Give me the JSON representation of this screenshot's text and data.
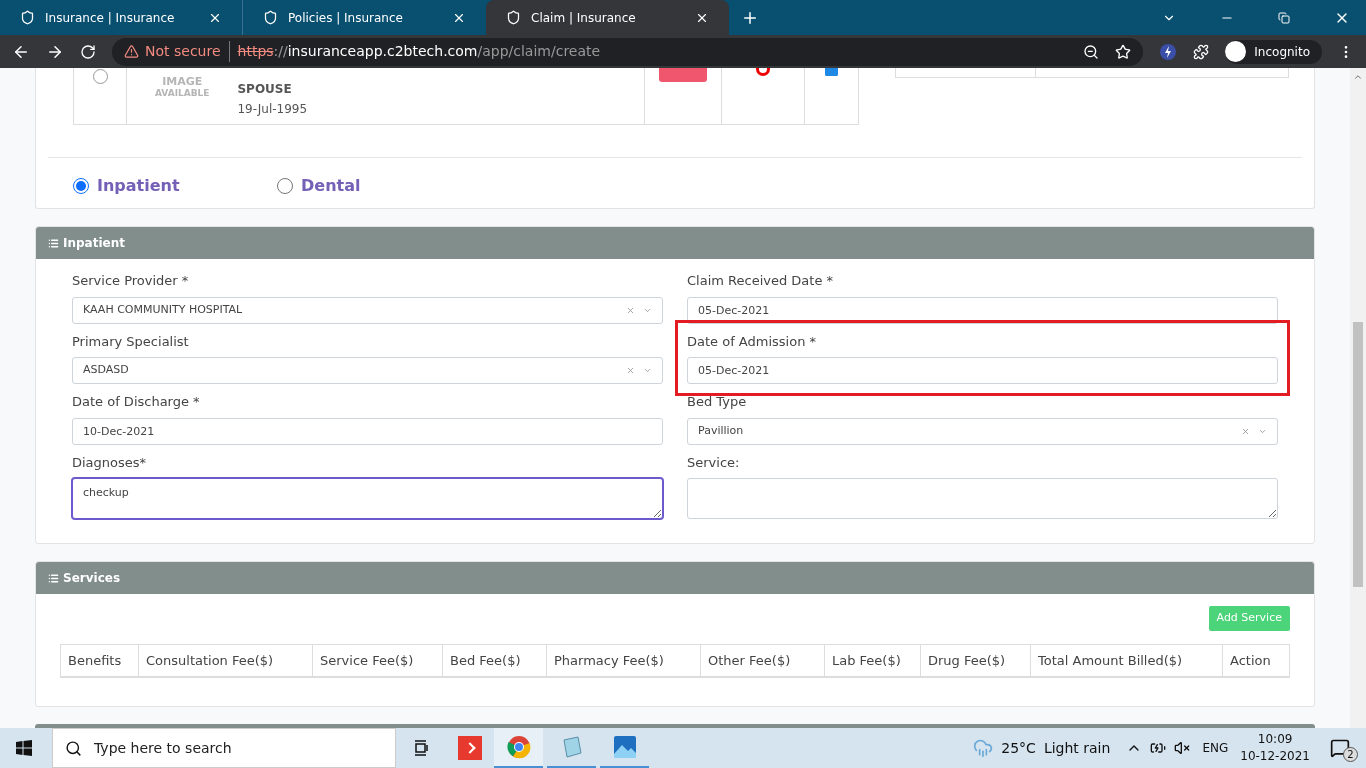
{
  "browser": {
    "tabs": [
      {
        "title": "Insurance | Insurance",
        "selected": false
      },
      {
        "title": "Policies | Insurance",
        "selected": false
      },
      {
        "title": "Claim | Insurance",
        "selected": true
      }
    ],
    "security": "Not secure",
    "url_scheme": "https",
    "url_rest": "://",
    "url_host": "insuranceapp.c2btech.com",
    "url_path": "/app/claim/create",
    "profile": "Incognito"
  },
  "member": {
    "image_text": [
      "IMAGE",
      "AVAILABLE"
    ],
    "relation": "SPOUSE",
    "dob": "19-Jul-1995",
    "selected": false,
    "checked": true
  },
  "claim_types": [
    {
      "label": "Inpatient",
      "selected": true
    },
    {
      "label": "Dental",
      "selected": false
    }
  ],
  "inpatient": {
    "title": "Inpatient",
    "fields": [
      {
        "label": "Service Provider *",
        "kind": "select",
        "value": "KAAH COMMUNITY HOSPITAL",
        "highlighted": false
      },
      {
        "label": "Claim Received Date *",
        "kind": "text",
        "value": "05-Dec-2021",
        "highlighted": false
      },
      {
        "label": "Primary Specialist",
        "kind": "select",
        "value": "ASDASD",
        "highlighted": false
      },
      {
        "label": "Date of Admission *",
        "kind": "text",
        "value": "05-Dec-2021",
        "highlighted": true
      },
      {
        "label": "Date of Discharge *",
        "kind": "text",
        "value": "10-Dec-2021",
        "highlighted": false
      },
      {
        "label": "Bed Type",
        "kind": "select",
        "value": "Pavillion",
        "highlighted": false
      },
      {
        "label": "Diagnoses*",
        "kind": "textarea",
        "value": "checkup",
        "focused": true,
        "highlighted": false
      },
      {
        "label": "Service:",
        "kind": "textarea",
        "focused": false,
        "highlighted": false
      }
    ]
  },
  "services": {
    "title": "Services",
    "add_button": "Add Service",
    "columns": [
      "Benefits",
      "Consultation Fee($)",
      "Service Fee($)",
      "Bed Fee($)",
      "Pharmacy Fee($)",
      "Other Fee($)",
      "Lab Fee($)",
      "Drug Fee($)",
      "Total Amount Billed($)",
      "Action"
    ]
  },
  "taskbar": {
    "search_placeholder": "Type here to search",
    "weather": "25°C",
    "weather_text": "Light rain",
    "language": "ENG",
    "time": "10:09",
    "date": "10-12-2021",
    "notifications": "2"
  }
}
